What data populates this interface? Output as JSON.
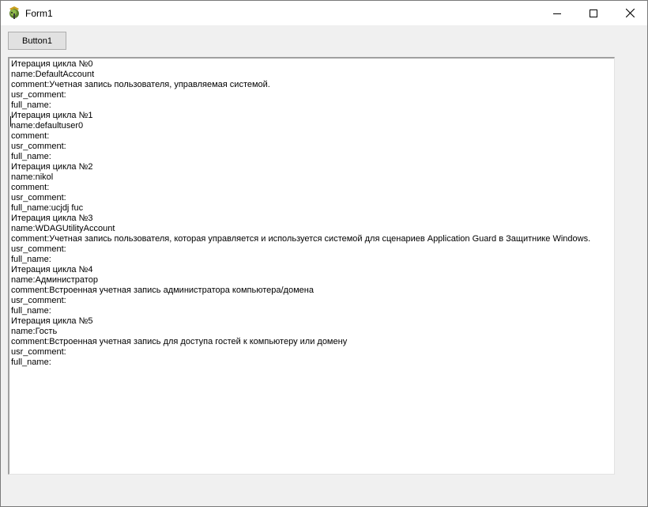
{
  "window": {
    "title": "Form1",
    "icon": "delphi-app-icon"
  },
  "caption_buttons": {
    "minimize": "minimize-icon",
    "maximize": "maximize-icon",
    "close": "close-icon"
  },
  "form": {
    "button1_label": "Button1"
  },
  "memo": {
    "lines": [
      "Итерация цикла №0",
      "name:DefaultAccount",
      "comment:Учетная запись пользователя, управляемая системой.",
      "usr_comment:",
      "full_name:",
      "Итерация цикла №1",
      "name:defaultuser0",
      "comment:",
      "usr_comment:",
      "full_name:",
      "Итерация цикла №2",
      "name:nikol",
      "comment:",
      "usr_comment:",
      "full_name:ucjdj fuc",
      "Итерация цикла №3",
      "name:WDAGUtilityAccount",
      "comment:Учетная запись пользователя, которая управляется и используется системой для сценариев Application Guard в Защитнике Windows.",
      "usr_comment:",
      "full_name:",
      "Итерация цикла №4",
      "name:Администратор",
      "comment:Встроенная учетная запись администратора компьютера/домена",
      "usr_comment:",
      "full_name:",
      "Итерация цикла №5",
      "name:Гость",
      "comment:Встроенная учетная запись для доступа гостей к компьютеру или домену",
      "usr_comment:",
      "full_name:"
    ]
  }
}
